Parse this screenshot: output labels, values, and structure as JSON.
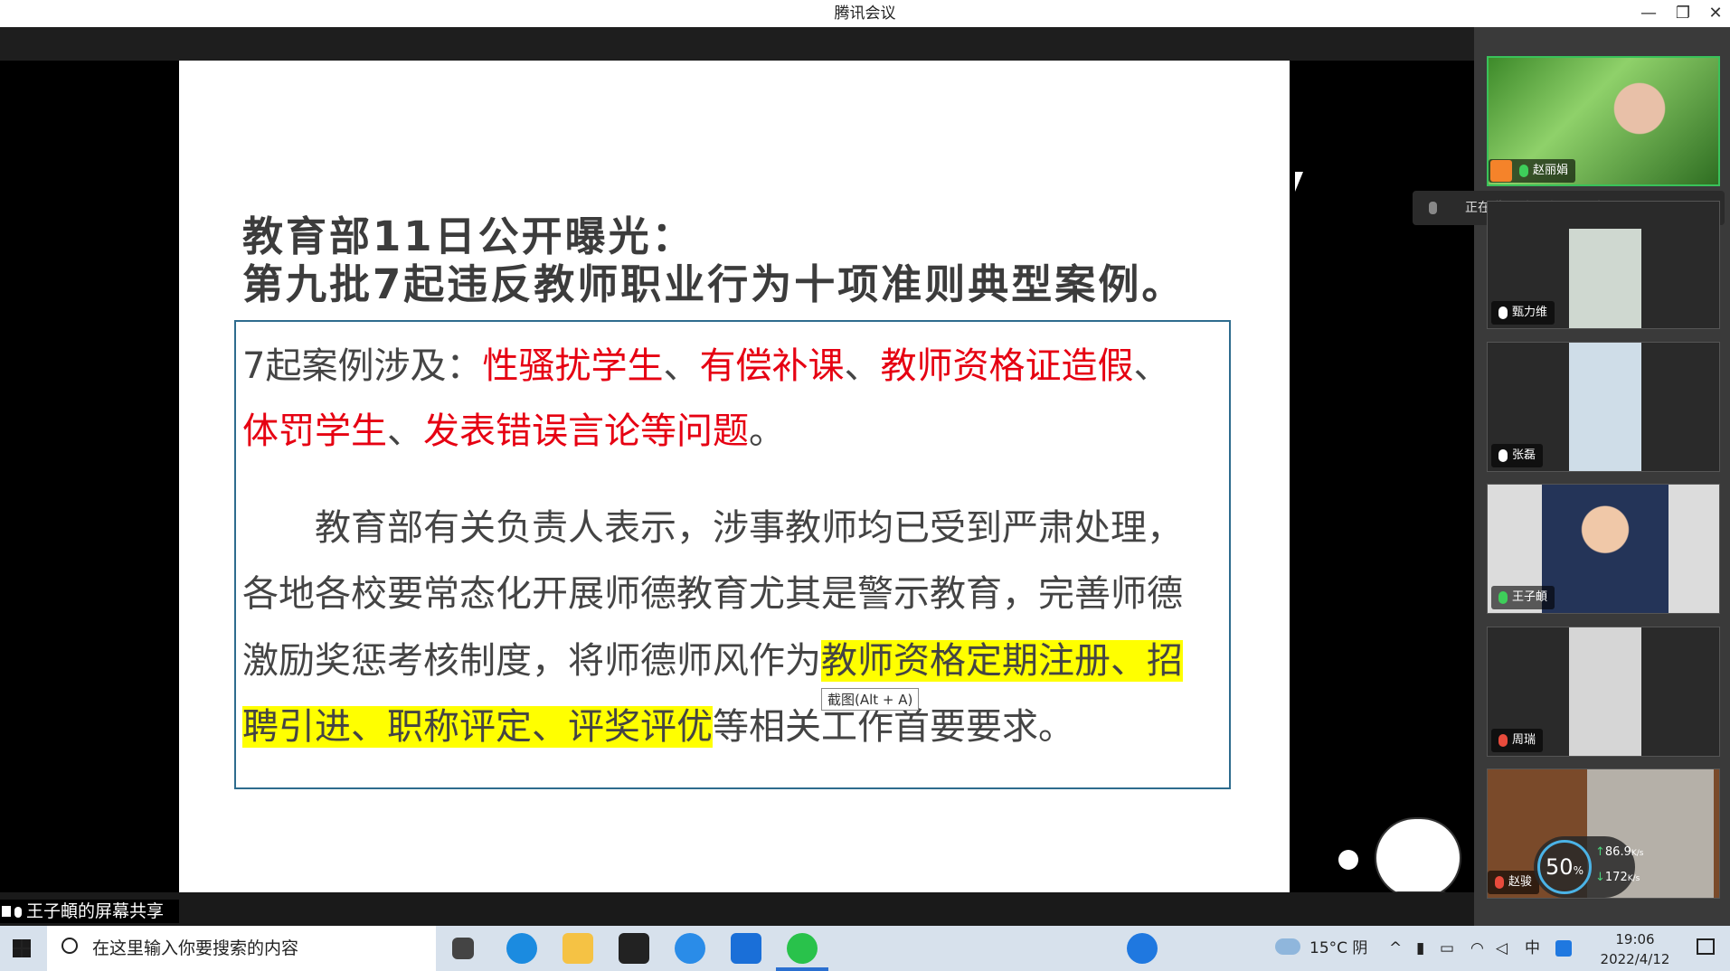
{
  "window": {
    "title": "腾讯会议"
  },
  "slide": {
    "title_line1": "教育部11日公开曝光：",
    "title_line2": "第九批7起违反教师职业行为十项准则典型案例。",
    "cases_prefix": "7起案例涉及：",
    "case1": "性骚扰学生",
    "sep": "、",
    "case2": "有偿补课",
    "case3": "教师资格证造假",
    "case4": "体罚学生",
    "case5": "发表错误言论等问题",
    "period": "。",
    "para_line1": "教育部有关负责人表示，涉事教师均已受到严肃处理，",
    "para_line2": "各地各校要常态化开展师德教育尤其是警示教育，完善师德",
    "para_line3_plain": "激励奖惩考核制度，将师德师风作为",
    "para_line3_hl": "教师资格定期注册、招",
    "para_line4_hl": "聘引进、职称评定、评奖评优",
    "para_line4_plain": "等相关工作首要要求。"
  },
  "tooltip": "截图(Alt + A)",
  "speaking": "正在讲话: 赵丽娟; 王子頔:...",
  "participants": [
    {
      "name": "赵丽娟"
    },
    {
      "name": "甄力维"
    },
    {
      "name": "张磊"
    },
    {
      "name": "王子頔"
    },
    {
      "name": "周瑞"
    },
    {
      "name": "赵骏"
    }
  ],
  "share_label": "王子頔的屏幕共享",
  "net": {
    "percent": "50",
    "unit": "%",
    "up": "86.9",
    "down": "172",
    "rate_unit": "K/s"
  },
  "taskbar": {
    "search_placeholder": "在这里输入你要搜索的内容",
    "weather": "15°C 阴",
    "ime": "中",
    "time": "19:06",
    "date": "2022/4/12"
  }
}
